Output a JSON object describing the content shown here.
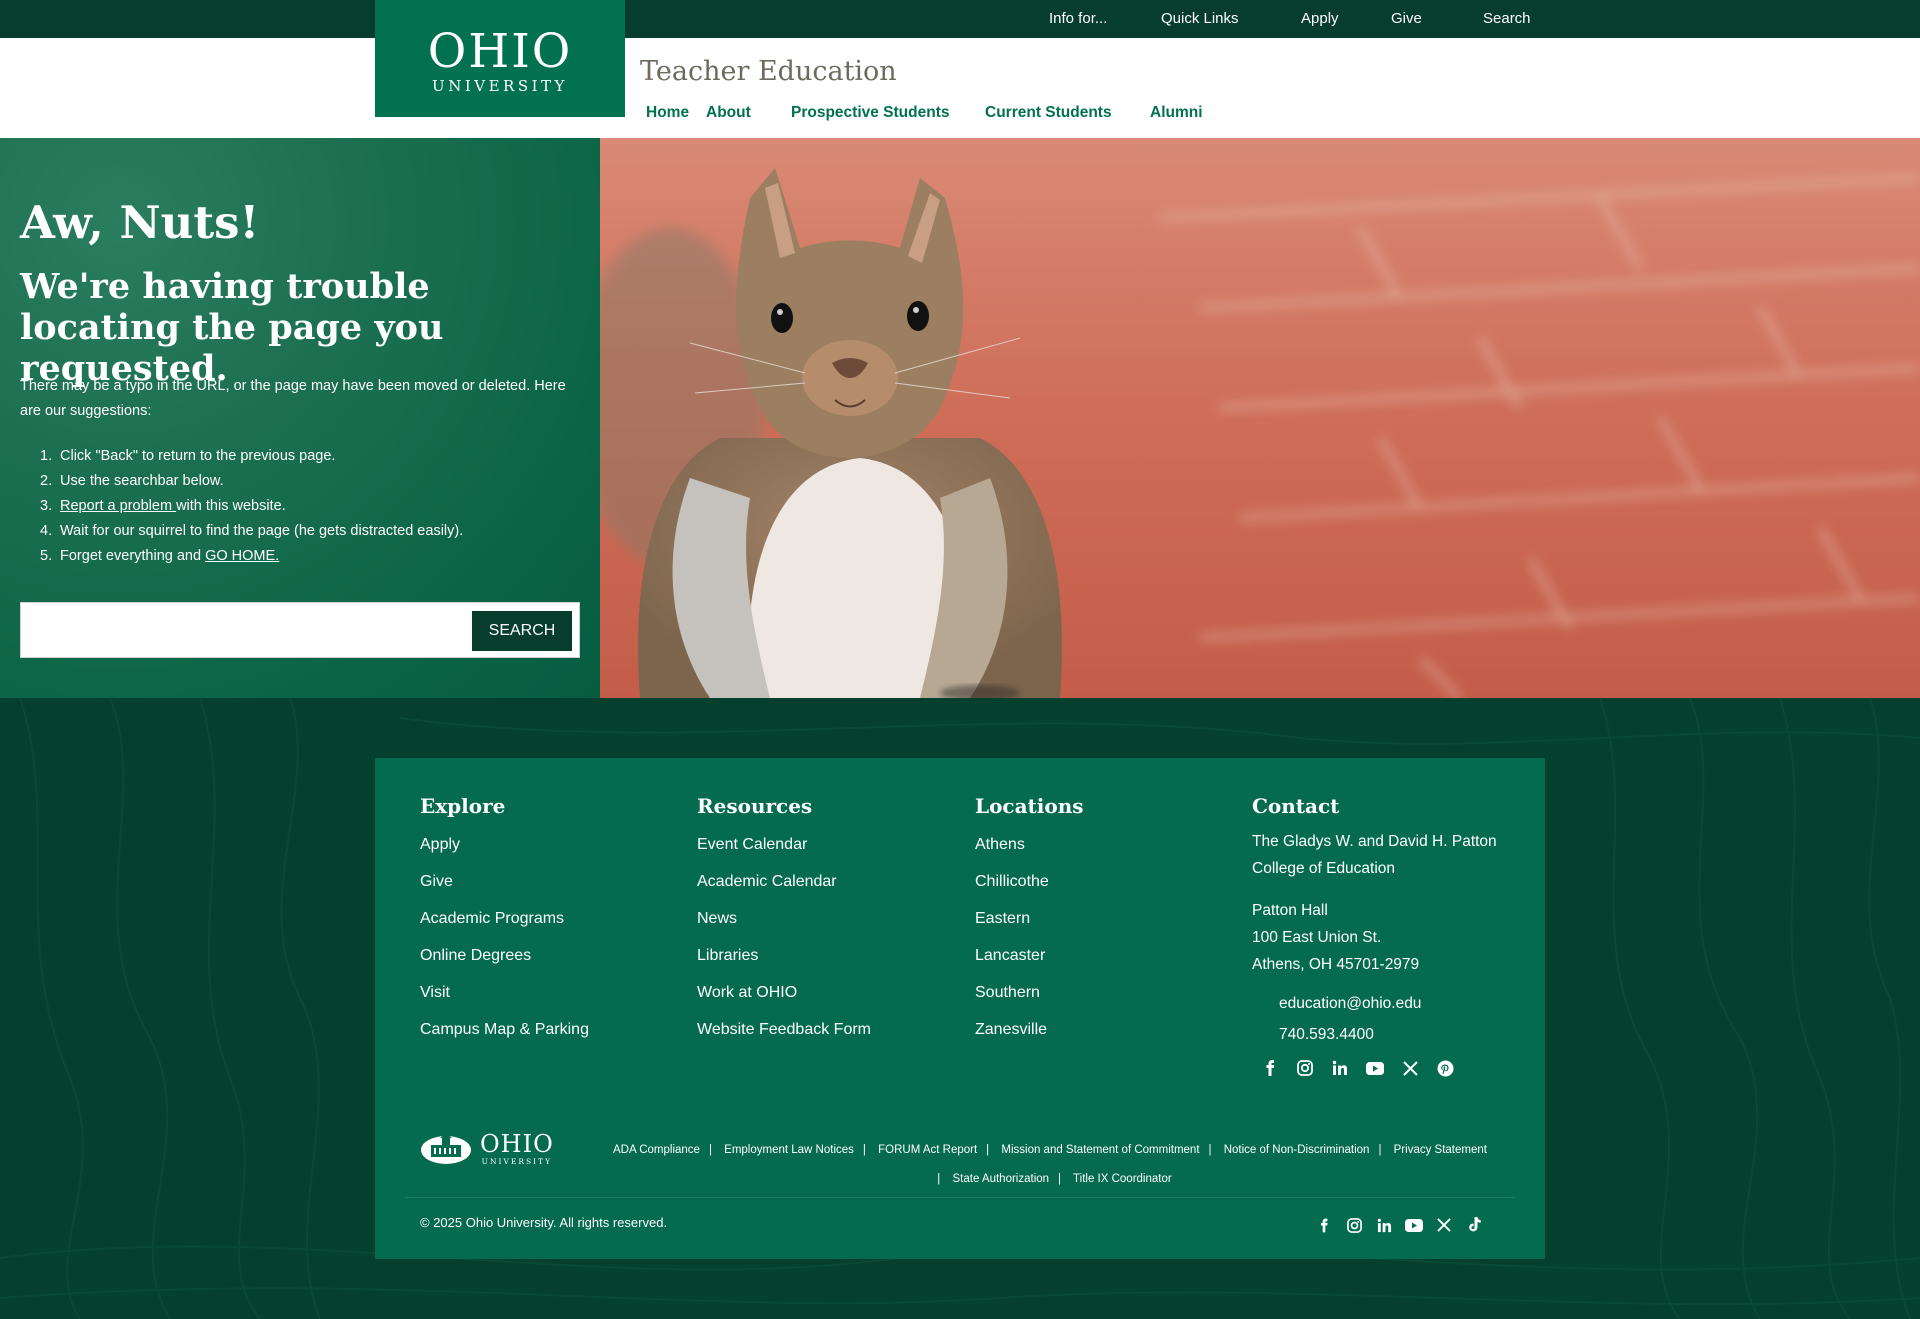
{
  "utility_nav": {
    "info": "Info for...",
    "quick_links": "Quick Links",
    "apply": "Apply",
    "give": "Give",
    "search": "Search"
  },
  "brand": {
    "logo_line1": "OHIO",
    "logo_line2": "UNIVERSITY",
    "site_title": "Teacher Education",
    "primary_color": "#02714f",
    "dark_color": "#063d2c"
  },
  "main_nav": {
    "home": "Home",
    "about": "About",
    "prospective": "Prospective Students",
    "current": "Current Students",
    "alumni": "Alumni"
  },
  "error": {
    "heading": "Aw, Nuts!",
    "subheading": "We're having trouble locating the page you requested.",
    "intro": "There may be a typo in the URL, or the page may have been moved or deleted. Here are our suggestions:",
    "steps": [
      {
        "num": "1.",
        "text": "Click \"Back\" to return to the previous page."
      },
      {
        "num": "2.",
        "text": "Use the searchbar below."
      },
      {
        "num": "3.",
        "link": "Report a problem ",
        "text": "with this website."
      },
      {
        "num": "4.",
        "text": "Wait for our squirrel to find the page (he gets distracted easily)."
      },
      {
        "num": "5.",
        "text": "Forget everything and ",
        "link": "GO HOME."
      }
    ],
    "search_placeholder": "",
    "search_button": "SEARCH",
    "image_subject": "squirrel-on-brick-path"
  },
  "footer": {
    "explore": {
      "heading": "Explore",
      "links": [
        "Apply",
        "Give",
        "Academic Programs",
        "Online Degrees",
        "Visit",
        "Campus Map & Parking"
      ]
    },
    "resources": {
      "heading": "Resources",
      "links": [
        "Event Calendar",
        "Academic Calendar",
        "News",
        "Libraries",
        "Work at OHIO",
        "Website Feedback Form"
      ]
    },
    "locations": {
      "heading": "Locations",
      "links": [
        "Athens",
        "Chillicothe",
        "Eastern",
        "Lancaster",
        "Southern",
        "Zanesville"
      ]
    },
    "contact": {
      "heading": "Contact",
      "college_line1": "The Gladys W. and David H. Patton",
      "college_line2": "College of Education",
      "building": "Patton Hall",
      "street": "100 East Union St.",
      "city": "Athens, OH 45701-2979",
      "email": "education@ohio.edu",
      "phone": "740.593.4400",
      "social": [
        "facebook-icon",
        "instagram-icon",
        "linkedin-icon",
        "youtube-icon",
        "x-icon",
        "pinterest-icon"
      ]
    },
    "logo_text": "OHIO",
    "logo_subtext": "UNIVERSITY",
    "legal_links": [
      "ADA Compliance",
      "Employment Law Notices",
      "FORUM Act Report",
      "Mission and Statement of Commitment",
      "Notice of Non-Discrimination",
      "Privacy Statement",
      "State Authorization",
      "Title IX Coordinator"
    ],
    "copyright": "© 2025 Ohio University. All rights reserved.",
    "bottom_social": [
      "facebook-icon",
      "instagram-icon",
      "linkedin-icon",
      "youtube-icon",
      "x-icon",
      "tiktok-icon"
    ]
  }
}
